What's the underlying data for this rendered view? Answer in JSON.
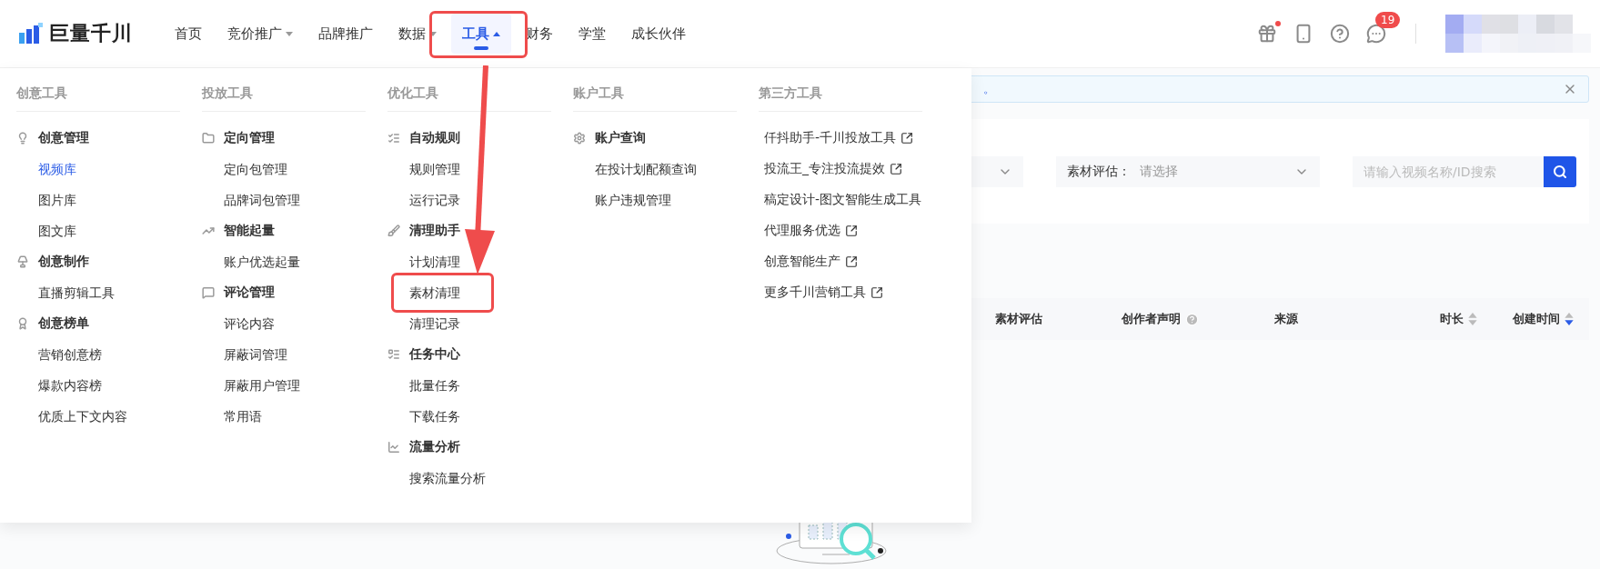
{
  "logo": {
    "text": "巨量千川"
  },
  "nav": [
    {
      "label": "首页",
      "selected": false,
      "dropdown": false
    },
    {
      "label": "竞价推广",
      "selected": false,
      "dropdown": true
    },
    {
      "label": "品牌推广",
      "selected": false,
      "dropdown": false
    },
    {
      "label": "数据",
      "selected": false,
      "dropdown": true
    },
    {
      "label": "工具",
      "selected": true,
      "dropdown": true
    },
    {
      "label": "财务",
      "selected": false,
      "dropdown": false
    },
    {
      "label": "学堂",
      "selected": false,
      "dropdown": false
    },
    {
      "label": "成长伙伴",
      "selected": false,
      "dropdown": false
    }
  ],
  "header_icons": [
    {
      "kind": "gift",
      "dot": true
    },
    {
      "kind": "phone"
    },
    {
      "kind": "help"
    },
    {
      "kind": "chat",
      "badge": "19"
    }
  ],
  "notice": {
    "text": "。"
  },
  "filters": {
    "select_label": "素材评估：",
    "select_placeholder": "请选择",
    "search_placeholder": "请输入视频名称/ID搜索"
  },
  "table_columns": [
    {
      "label": "素材评估"
    },
    {
      "label": "创作者声明",
      "help": true
    },
    {
      "label": "来源"
    },
    {
      "label": "时长",
      "sortable": true,
      "sorted_desc": false
    },
    {
      "label": "创建时间",
      "sortable": true,
      "sorted_desc": true
    }
  ],
  "mega_menu": [
    {
      "title": "创意工具",
      "groups": [
        {
          "title": "创意管理",
          "kind": "bulb",
          "items": [
            {
              "label": "视频库",
              "selected": true
            },
            {
              "label": "图片库",
              "selected": false
            },
            {
              "label": "图文库",
              "selected": false
            }
          ]
        },
        {
          "title": "创意制作",
          "kind": "lamp",
          "items": [
            {
              "label": "直播剪辑工具",
              "selected": false
            }
          ]
        },
        {
          "title": "创意榜单",
          "kind": "award",
          "items": [
            {
              "label": "营销创意榜",
              "selected": false
            },
            {
              "label": "爆款内容榜",
              "selected": false
            },
            {
              "label": "优质上下文内容",
              "selected": false
            }
          ]
        }
      ]
    },
    {
      "title": "投放工具",
      "groups": [
        {
          "title": "定向管理",
          "kind": "folder",
          "items": [
            {
              "label": "定向包管理",
              "selected": false
            },
            {
              "label": "品牌词包管理",
              "selected": false
            }
          ]
        },
        {
          "title": "智能起量",
          "kind": "trend",
          "items": [
            {
              "label": "账户优选起量",
              "selected": false
            }
          ]
        },
        {
          "title": "评论管理",
          "kind": "comment",
          "items": [
            {
              "label": "评论内容",
              "selected": false
            },
            {
              "label": "屏蔽词管理",
              "selected": false
            },
            {
              "label": "屏蔽用户管理",
              "selected": false
            },
            {
              "label": "常用语",
              "selected": false
            }
          ]
        }
      ]
    },
    {
      "title": "优化工具",
      "groups": [
        {
          "title": "自动规则",
          "kind": "rules",
          "items": [
            {
              "label": "规则管理",
              "selected": false
            },
            {
              "label": "运行记录",
              "selected": false
            }
          ]
        },
        {
          "title": "清理助手",
          "kind": "broom",
          "items": [
            {
              "label": "计划清理",
              "selected": false
            },
            {
              "label": "素材清理",
              "selected": false
            },
            {
              "label": "清理记录",
              "selected": false
            }
          ]
        },
        {
          "title": "任务中心",
          "kind": "tasks",
          "items": [
            {
              "label": "批量任务",
              "selected": false
            },
            {
              "label": "下载任务",
              "selected": false
            }
          ]
        },
        {
          "title": "流量分析",
          "kind": "chart",
          "items": [
            {
              "label": "搜索流量分析",
              "selected": false
            }
          ]
        }
      ]
    },
    {
      "title": "账户工具",
      "groups": [
        {
          "title": "账户查询",
          "kind": "gear",
          "items": [
            {
              "label": "在投计划配额查询",
              "selected": false
            },
            {
              "label": "账户违规管理",
              "selected": false
            }
          ]
        }
      ]
    },
    {
      "title": "第三方工具",
      "links": [
        {
          "label": "仟抖助手-千川投放工具"
        },
        {
          "label": "投流王_专注投流提效"
        },
        {
          "label": "稿定设计-图文智能生成工具"
        },
        {
          "label": "代理服务优选"
        },
        {
          "label": "创意智能生产"
        },
        {
          "label": "更多千川营销工具"
        }
      ]
    }
  ]
}
